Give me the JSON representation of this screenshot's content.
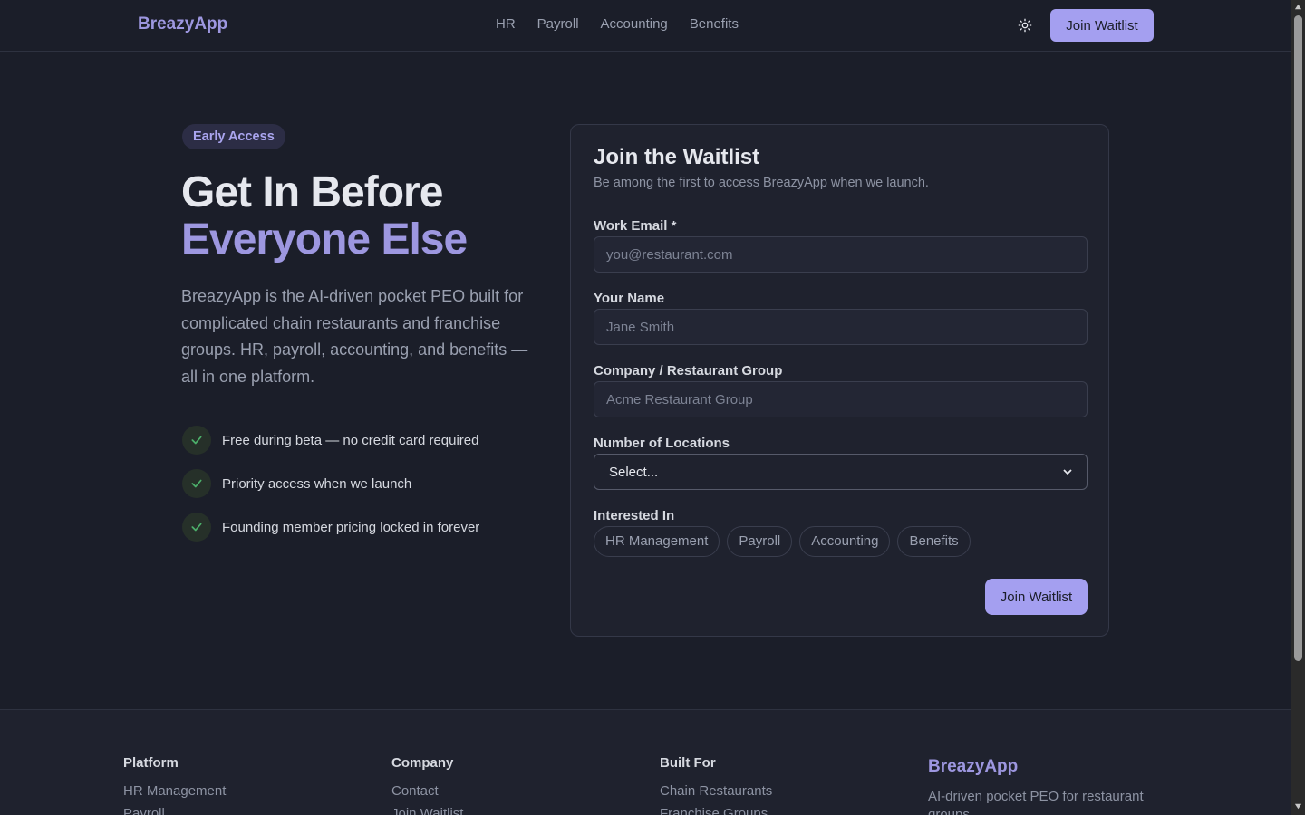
{
  "header": {
    "brand": "BreazyApp",
    "nav": [
      "HR",
      "Payroll",
      "Accounting",
      "Benefits"
    ],
    "cta_label": "Join Waitlist"
  },
  "hero": {
    "badge": "Early Access",
    "title_line1": "Get In Before",
    "title_line2": "Everyone Else",
    "description": "BreazyApp is the AI-driven pocket PEO built for complicated chain restaurants and franchise groups. HR, payroll, accounting, and benefits — all in one platform.",
    "features": [
      "Free during beta — no credit card required",
      "Priority access when we launch",
      "Founding member pricing locked in forever"
    ]
  },
  "form": {
    "title": "Join the Waitlist",
    "subtitle": "Be among the first to access BreazyApp when we launch.",
    "email_label": "Work Email *",
    "email_placeholder": "you@restaurant.com",
    "name_label": "Your Name",
    "name_placeholder": "Jane Smith",
    "company_label": "Company / Restaurant Group",
    "company_placeholder": "Acme Restaurant Group",
    "locations_label": "Number of Locations",
    "locations_selected": "Select...",
    "interest_label": "Interested In",
    "interests": [
      "HR Management",
      "Payroll",
      "Accounting",
      "Benefits"
    ],
    "submit_label": "Join Waitlist"
  },
  "footer": {
    "columns": [
      {
        "title": "Platform",
        "links": [
          "HR Management",
          "Payroll"
        ]
      },
      {
        "title": "Company",
        "links": [
          "Contact",
          "Join Waitlist"
        ]
      },
      {
        "title": "Built For",
        "links": [
          "Chain Restaurants",
          "Franchise Groups"
        ]
      }
    ],
    "brand": "BreazyApp",
    "description": "AI-driven pocket PEO for restaurant groups."
  },
  "colors": {
    "background": "#1b1e29",
    "accent": "#a49ff0",
    "check": "#4caf6a"
  }
}
